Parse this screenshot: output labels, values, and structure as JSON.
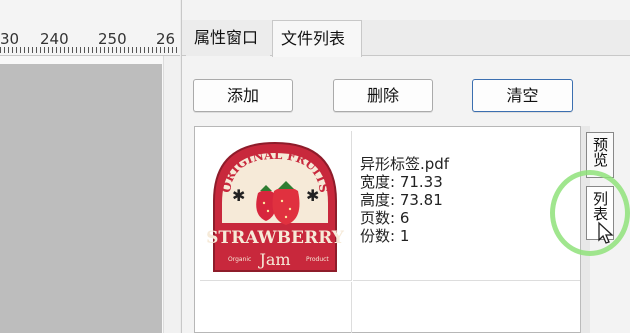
{
  "ruler": {
    "labels": [
      "30",
      "240",
      "250",
      "26"
    ]
  },
  "tabs": {
    "properties": "属性窗口",
    "file_list": "文件列表"
  },
  "buttons": {
    "add": "添加",
    "delete": "删除",
    "clear": "清空"
  },
  "file": {
    "name": "异形标签.pdf",
    "width": "宽度: 71.33",
    "height": "高度: 73.81",
    "pages": "页数: 6",
    "copies": "份数: 1"
  },
  "label_art": {
    "top_text": "ORIGINAL FRUITS",
    "main_text": "STRAWBERRY",
    "bottom_text": "Jam",
    "left_small": "Organic",
    "right_small": "Product"
  },
  "side_tabs": {
    "preview": "预览",
    "list": "列表"
  },
  "colors": {
    "label_red": "#c8283c",
    "label_cream": "#f6ead8",
    "accent_blue": "#3b6fb0",
    "highlight_green": "#8fe27a"
  }
}
